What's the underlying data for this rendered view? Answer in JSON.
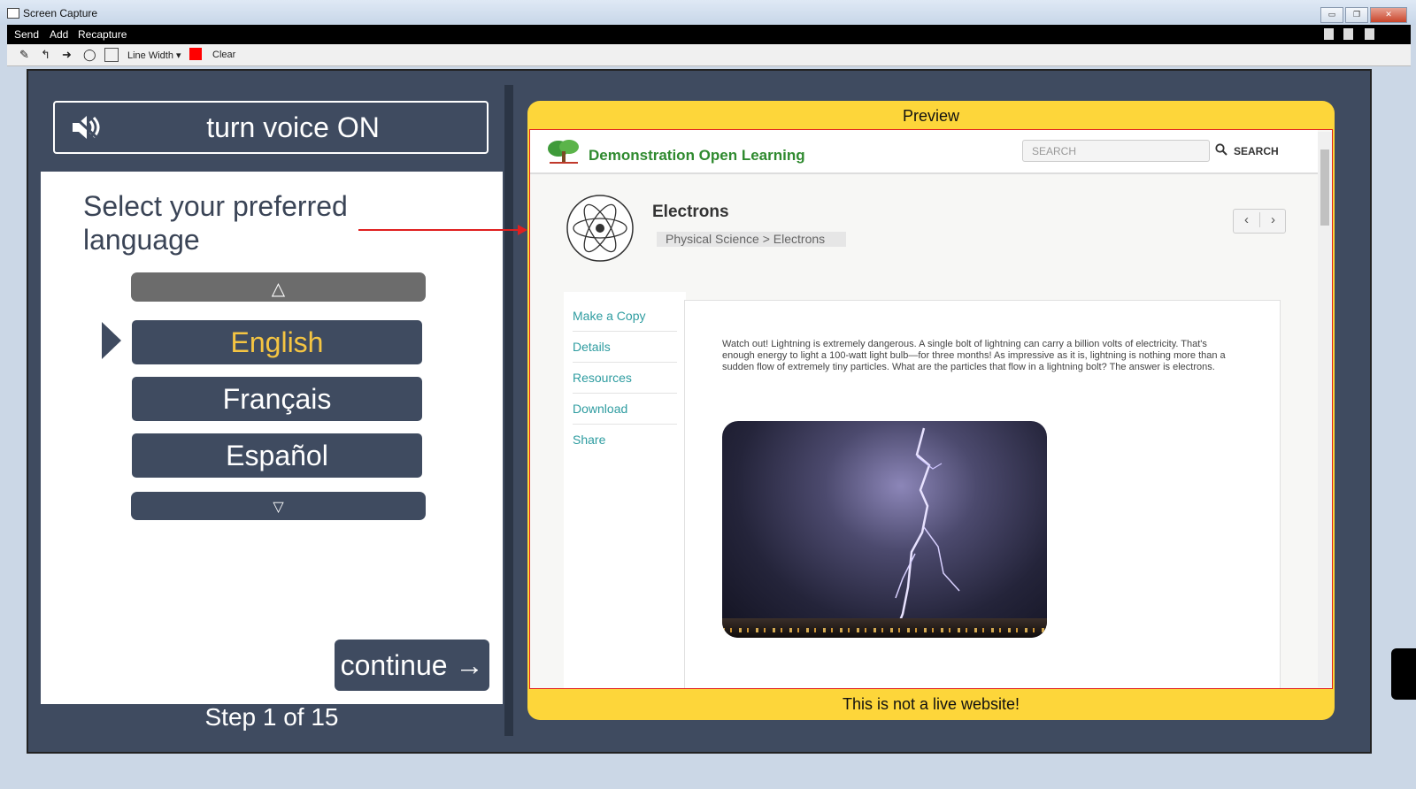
{
  "window": {
    "title": "Screen Capture",
    "buttons": [
      "▭",
      "❐",
      "✕"
    ]
  },
  "menu": {
    "items": [
      "Send",
      "Add",
      "Recapture"
    ]
  },
  "toolbar": {
    "line_width_label": "Line Width",
    "clear_label": "Clear",
    "color": "#ff0000"
  },
  "left": {
    "voice_label": "turn voice ON",
    "prompt": "Select your preferred language",
    "up_symbol": "△",
    "languages": [
      "English",
      "Français",
      "Español"
    ],
    "down_symbol": "▽",
    "continue_label": "continue →",
    "step_label": "Step 1 of 15",
    "selected_color": "#f5c542"
  },
  "preview": {
    "header_label": "Preview",
    "footer_label": "This is not a live website!",
    "site_name": "Demonstration Open Learning",
    "search_placeholder": "SEARCH",
    "search_label": "SEARCH",
    "article_title": "Electrons",
    "breadcrumb": "Physical Science > Electrons",
    "pager": {
      "prev": "‹",
      "next": "›"
    },
    "side_nav": [
      "Make a Copy",
      "Details",
      "Resources",
      "Download",
      "Share"
    ],
    "paragraph": "Watch out! Lightning is extremely dangerous. A single bolt of lightning can carry a billion volts of electricity. That's enough energy to light a 100-watt light bulb—for three months! As impressive as it is, lightning is nothing more than a sudden flow of extremely tiny particles. What are the particles that flow in a lightning bolt? The answer is electrons."
  }
}
